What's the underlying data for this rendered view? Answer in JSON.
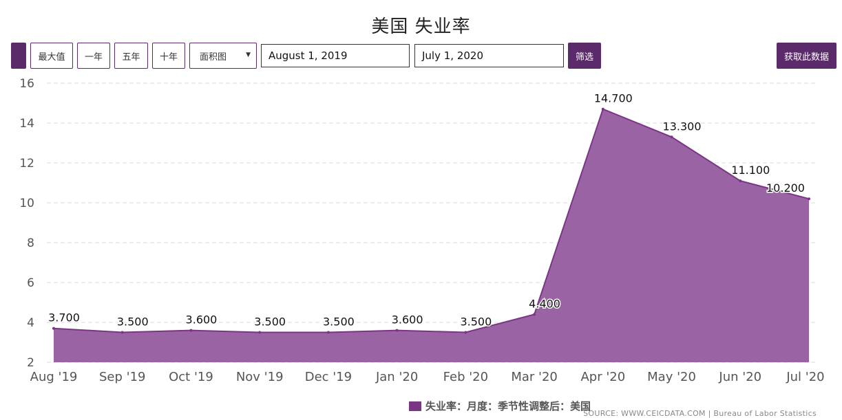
{
  "header": {
    "title": "美国 失业率"
  },
  "toolbar": {
    "btn_max": "最大值",
    "btn_1y": "一年",
    "btn_5y": "五年",
    "btn_10y": "十年",
    "chart_type": "面积图",
    "start_date": "August 1, 2019",
    "end_date": "July 1, 2020",
    "filter": "筛选",
    "get_data": "获取此数据"
  },
  "legend": {
    "label": "失业率：月度：季节性调整后：美国"
  },
  "source": "SOURCE: WWW.CEICDATA.COM | Bureau of Labor Statistics",
  "colors": {
    "accent": "#5b2a6b",
    "fill": "#9a63a4",
    "line": "#7b3585"
  },
  "chart_data": {
    "type": "area",
    "title": "美国 失业率",
    "categories": [
      "Aug '19",
      "Sep '19",
      "Oct '19",
      "Nov '19",
      "Dec '19",
      "Jan '20",
      "Feb '20",
      "Mar '20",
      "Apr '20",
      "May '20",
      "Jun '20",
      "Jul '20"
    ],
    "series": [
      {
        "name": "失业率：月度：季节性调整后：美国",
        "values": [
          3.7,
          3.5,
          3.6,
          3.5,
          3.5,
          3.6,
          3.5,
          4.4,
          14.7,
          13.3,
          11.1,
          10.2
        ],
        "labels": [
          "3.700",
          "3.500",
          "3.600",
          "3.500",
          "3.500",
          "3.600",
          "3.500",
          "4.400",
          "14.700",
          "13.300",
          "11.100",
          "10.200"
        ]
      }
    ],
    "yticks": [
      "2",
      "4",
      "6",
      "8",
      "10",
      "12",
      "14",
      "16"
    ],
    "ylim": [
      2,
      16
    ],
    "grid": true,
    "legend_position": "bottom"
  }
}
